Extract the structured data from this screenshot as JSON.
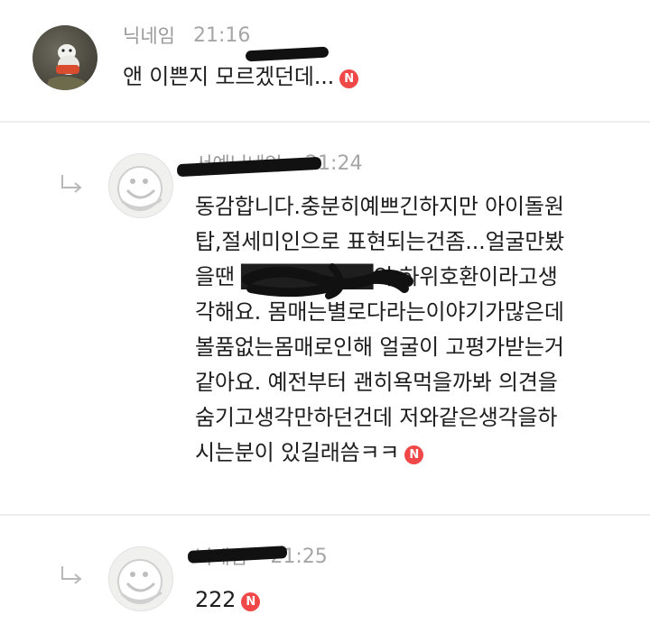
{
  "comments": [
    {
      "author": "닉네임",
      "time": "21:16",
      "text": "앤 이쁜지 모르겠던데...",
      "badge": "N",
      "avatar_icon": "cat-photo-avatar",
      "is_reply": false
    },
    {
      "author": "서예닉네임",
      "time": "21:24",
      "text": "동감합니다.충분히예쁘긴하지만 아이돌원\n탑,절세미인으로 표현되는건좀...얼굴만봤\n을땐 ████████의 하위호환이라고생\n각해요. 몸매는별로다라는이야기가많은데\n볼품없는몸매로인해 얼굴이 고평가받는거\n같아요. 예전부터 괜히욕먹을까봐 의견을\n숨기고생각만하던건데 저와같은생각을하\n시는분이 있길래씀ㅋㅋ",
      "badge": "N",
      "avatar_icon": "default-character-avatar",
      "is_reply": true
    },
    {
      "author": "닉네임",
      "time": "21:25",
      "text": "222",
      "badge": "N",
      "avatar_icon": "default-character-avatar",
      "is_reply": true
    }
  ],
  "colors": {
    "badge": "#f04848",
    "meta": "#a6a6a6",
    "divider": "#ececec"
  }
}
